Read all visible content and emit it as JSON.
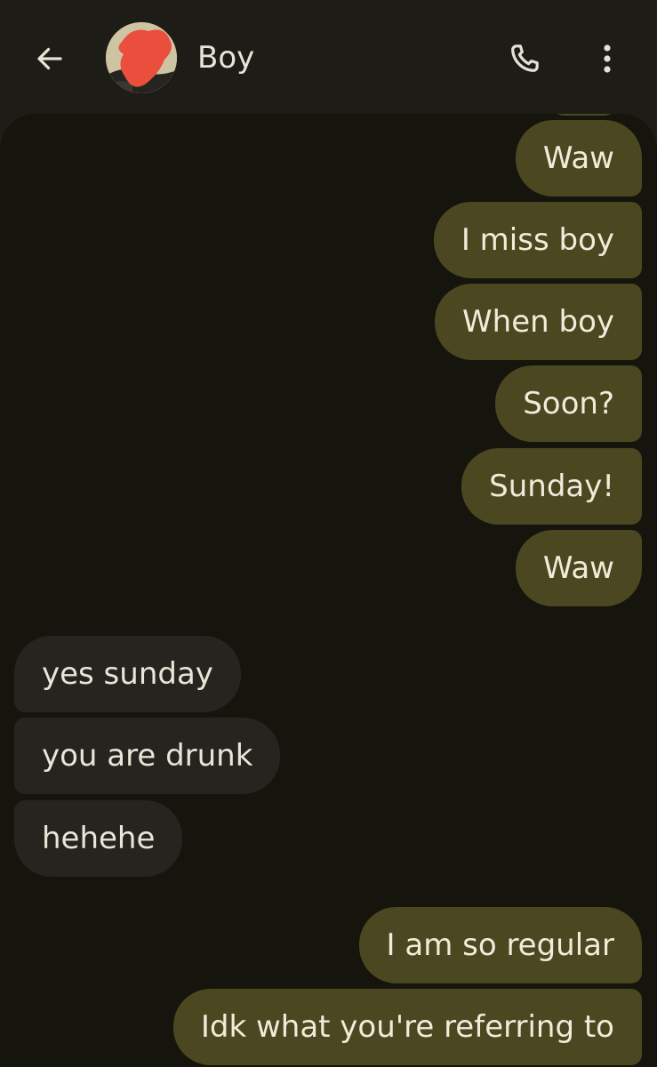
{
  "header": {
    "contact_name": "Boy",
    "back_icon": "arrow-left-icon",
    "call_icon": "phone-icon",
    "more_icon": "more-vertical-icon"
  },
  "messages": [
    {
      "direction": "outgoing",
      "text": "Waw"
    },
    {
      "direction": "outgoing",
      "text": "I miss boy"
    },
    {
      "direction": "outgoing",
      "text": "When boy"
    },
    {
      "direction": "outgoing",
      "text": "Soon?"
    },
    {
      "direction": "outgoing",
      "text": "Sunday!"
    },
    {
      "direction": "outgoing",
      "text": "Waw"
    },
    {
      "direction": "incoming",
      "text": "yes sunday"
    },
    {
      "direction": "incoming",
      "text": "you are drunk"
    },
    {
      "direction": "incoming",
      "text": "hehehe"
    },
    {
      "direction": "outgoing",
      "text": "I am so regular"
    },
    {
      "direction": "outgoing",
      "text": "Idk what you're referring to"
    }
  ],
  "colors": {
    "outgoing_bubble": "#4b4720",
    "incoming_bubble": "#26241f",
    "conversation_bg": "#15140d",
    "header_bg": "#1e1c16"
  }
}
